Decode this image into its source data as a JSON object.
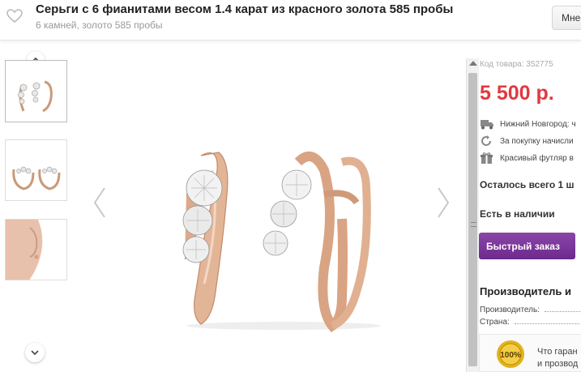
{
  "header": {
    "title": "Серьги с 6 фианитами весом 1.4 карат из красного золота 585 пробы",
    "subtitle": "6 камней, золото 585 пробы",
    "more_label": "Мне",
    "favorite_icon": "heart-icon"
  },
  "gallery": {
    "thumbnails": [
      {
        "alt": "earrings-front"
      },
      {
        "alt": "earrings-side"
      },
      {
        "alt": "earring-on-model"
      }
    ],
    "prev_icon": "chevron-left-icon",
    "next_icon": "chevron-right-icon",
    "scroll_up_icon": "chevron-up-icon",
    "scroll_down_icon": "chevron-down-icon"
  },
  "product": {
    "code": "Код товара: 352775",
    "price": "5 500 р.",
    "delivery": "Нижний Новгород: ч",
    "bonus": "За покупку начисли",
    "gift": "Красивый футляр в",
    "remaining": "Осталось всего 1 ш",
    "stock": "Есть в наличии",
    "quick_order": "Быстрый заказ"
  },
  "maker": {
    "heading": "Производитель и",
    "manufacturer_label": "Производитель:",
    "country_label": "Страна:"
  },
  "guarantee": {
    "line1": "Что гаран",
    "line2": "и прозвод",
    "seal_text": "100%"
  },
  "colors": {
    "price": "#e13940",
    "button": "#7a3499",
    "seal": "#e3b21c"
  }
}
